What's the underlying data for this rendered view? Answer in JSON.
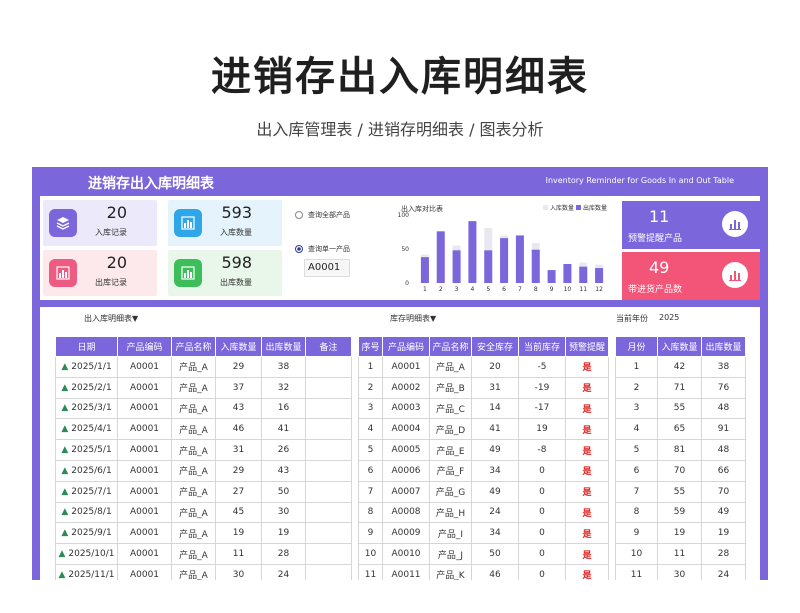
{
  "hero": {
    "title": "进销存出入库明细表",
    "subtitle": "出入库管理表 / 进销存明细表 / 图表分析"
  },
  "sheet": {
    "title": "进销存出入库明细表",
    "en_title": "Inventory Reminder for Goods In and Out Table"
  },
  "stats": {
    "in_records": {
      "value": "20",
      "label": "入库记录"
    },
    "in_qty": {
      "value": "593",
      "label": "入库数量"
    },
    "out_records": {
      "value": "20",
      "label": "出库记录"
    },
    "out_qty": {
      "value": "598",
      "label": "出库数量"
    }
  },
  "filter": {
    "all_label": "查询全部产品",
    "single_label": "查询单一产品",
    "product_value": "A0001"
  },
  "alerts": {
    "warn": {
      "value": "11",
      "label": "预警提醒产品"
    },
    "restock": {
      "value": "49",
      "label": "带进货产品数"
    }
  },
  "chart_data": {
    "type": "bar",
    "title": "出入库对比表",
    "categories": [
      "1",
      "2",
      "3",
      "4",
      "5",
      "6",
      "7",
      "8",
      "9",
      "10",
      "11",
      "12"
    ],
    "series": [
      {
        "name": "入库数量",
        "values": [
          42,
          71,
          55,
          65,
          81,
          70,
          55,
          59,
          19,
          11,
          30,
          27
        ]
      },
      {
        "name": "出库数量",
        "values": [
          38,
          76,
          48,
          91,
          48,
          66,
          70,
          49,
          19,
          28,
          24,
          22
        ]
      }
    ],
    "ylim": [
      0,
      100
    ],
    "yticks": [
      "0",
      "50",
      "100"
    ],
    "legend": "top-right",
    "colors": {
      "in": "#e9e8f1",
      "out": "#7b66dc"
    }
  },
  "sections": {
    "in_out_title": "出入库明细表▼",
    "stock_title": "库存明细表▼",
    "year_label": "当前年份",
    "year_value": "2025"
  },
  "in_out_table": {
    "headers": [
      "日期",
      "产品编码",
      "产品名称",
      "入库数量",
      "出库数量",
      "备注"
    ],
    "rows": [
      [
        "2025/1/1",
        "A0001",
        "产品_A",
        "29",
        "38",
        ""
      ],
      [
        "2025/2/1",
        "A0001",
        "产品_A",
        "37",
        "32",
        ""
      ],
      [
        "2025/3/1",
        "A0001",
        "产品_A",
        "43",
        "16",
        ""
      ],
      [
        "2025/4/1",
        "A0001",
        "产品_A",
        "46",
        "41",
        ""
      ],
      [
        "2025/5/1",
        "A0001",
        "产品_A",
        "31",
        "26",
        ""
      ],
      [
        "2025/6/1",
        "A0001",
        "产品_A",
        "29",
        "43",
        ""
      ],
      [
        "2025/7/1",
        "A0001",
        "产品_A",
        "27",
        "50",
        ""
      ],
      [
        "2025/8/1",
        "A0001",
        "产品_A",
        "45",
        "30",
        ""
      ],
      [
        "2025/9/1",
        "A0001",
        "产品_A",
        "19",
        "19",
        ""
      ],
      [
        "2025/10/1",
        "A0001",
        "产品_A",
        "11",
        "28",
        ""
      ],
      [
        "2025/11/1",
        "A0001",
        "产品_A",
        "30",
        "24",
        ""
      ]
    ]
  },
  "stock_table": {
    "headers": [
      "序号",
      "产品编码",
      "产品名称",
      "安全库存",
      "当前库存",
      "预警提醒"
    ],
    "rows": [
      [
        "1",
        "A0001",
        "产品_A",
        "20",
        "-5",
        "是"
      ],
      [
        "2",
        "A0002",
        "产品_B",
        "31",
        "-19",
        "是"
      ],
      [
        "3",
        "A0003",
        "产品_C",
        "14",
        "-17",
        "是"
      ],
      [
        "4",
        "A0004",
        "产品_D",
        "41",
        "19",
        "是"
      ],
      [
        "5",
        "A0005",
        "产品_E",
        "49",
        "-8",
        "是"
      ],
      [
        "6",
        "A0006",
        "产品_F",
        "34",
        "0",
        "是"
      ],
      [
        "7",
        "A0007",
        "产品_G",
        "49",
        "0",
        "是"
      ],
      [
        "8",
        "A0008",
        "产品_H",
        "24",
        "0",
        "是"
      ],
      [
        "9",
        "A0009",
        "产品_I",
        "34",
        "0",
        "是"
      ],
      [
        "10",
        "A0010",
        "产品_J",
        "50",
        "0",
        "是"
      ],
      [
        "11",
        "A0011",
        "产品_K",
        "46",
        "0",
        "是"
      ]
    ]
  },
  "month_table": {
    "headers": [
      "月份",
      "入库数量",
      "出库数量"
    ],
    "rows": [
      [
        "1",
        "42",
        "38"
      ],
      [
        "2",
        "71",
        "76"
      ],
      [
        "3",
        "55",
        "48"
      ],
      [
        "4",
        "65",
        "91"
      ],
      [
        "5",
        "81",
        "48"
      ],
      [
        "6",
        "70",
        "66"
      ],
      [
        "7",
        "55",
        "70"
      ],
      [
        "8",
        "59",
        "49"
      ],
      [
        "9",
        "19",
        "19"
      ],
      [
        "10",
        "11",
        "28"
      ],
      [
        "11",
        "30",
        "24"
      ]
    ]
  }
}
